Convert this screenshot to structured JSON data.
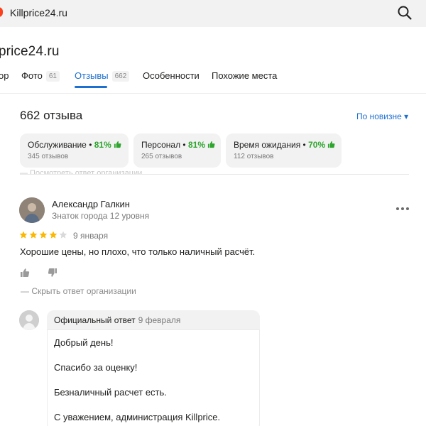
{
  "topbar": {
    "domain": "Killprice24.ru",
    "search_icon": "search-icon"
  },
  "business": {
    "title": "price24.ru"
  },
  "tabs": [
    {
      "label": "ор",
      "count": ""
    },
    {
      "label": "Фото",
      "count": "61"
    },
    {
      "label": "Отзывы",
      "count": "662"
    },
    {
      "label": "Особенности",
      "count": ""
    },
    {
      "label": "Похожие места",
      "count": ""
    }
  ],
  "reviews": {
    "count_label": "662 отзыва",
    "sort_label": "По новизне ▾",
    "categories": [
      {
        "name": "Обслуживание",
        "percent": "81%",
        "sub": "345 отзывов"
      },
      {
        "name": "Персонал",
        "percent": "81%",
        "sub": "265 отзывов"
      },
      {
        "name": "Время ожидания",
        "percent": "70%",
        "sub": "112 отзывов"
      }
    ],
    "clipped_hint": "— Посмотреть ответ организации",
    "accent": "#1d6fd0",
    "positive": "#2ea52e",
    "star_color": "#fcb800"
  },
  "review": {
    "author": "Александр Галкин",
    "level": "Знаток города 12 уровня",
    "rating": 4,
    "max_rating": 5,
    "date": "9 января",
    "text": "Хорошие цены, но плохо, что только наличный расчёт.",
    "hide_reply": "— Скрыть ответ организации",
    "reply": {
      "title": "Официальный ответ",
      "date": "9 февраля",
      "lines": [
        "Добрый день!",
        "Спасибо за оценку!",
        "Безналичный расчет есть.",
        "С уважением, администрация Killprice."
      ]
    }
  }
}
